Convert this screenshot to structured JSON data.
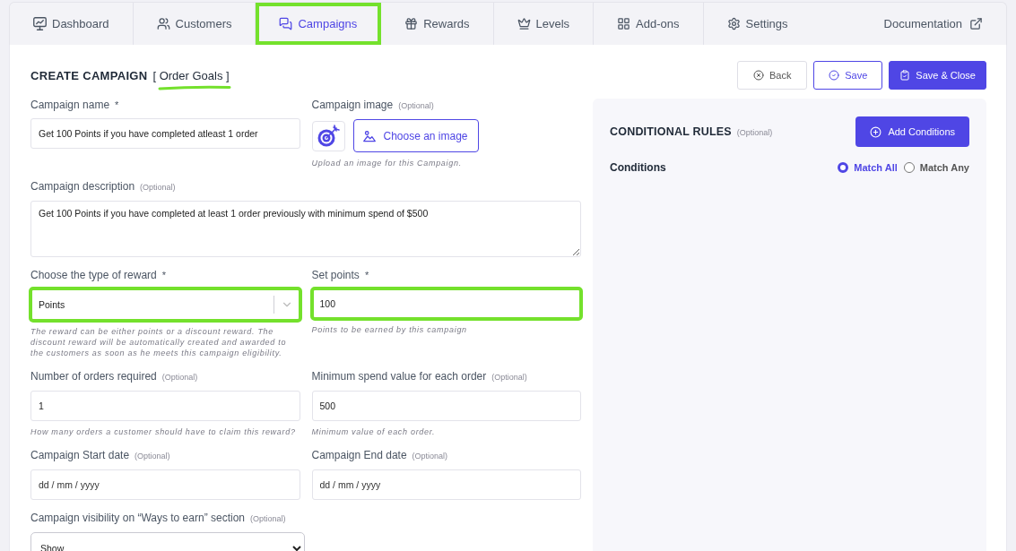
{
  "tabs": [
    {
      "label": "Dashboard",
      "selected": false,
      "highlighted": false
    },
    {
      "label": "Customers",
      "selected": false,
      "highlighted": false
    },
    {
      "label": "Campaigns",
      "selected": true,
      "highlighted": true
    },
    {
      "label": "Rewards",
      "selected": false,
      "highlighted": false
    },
    {
      "label": "Levels",
      "selected": false,
      "highlighted": false
    },
    {
      "label": "Add-ons",
      "selected": false,
      "highlighted": false
    },
    {
      "label": "Settings",
      "selected": false,
      "highlighted": false
    }
  ],
  "documentation_link": {
    "label": "Documentation"
  },
  "header": {
    "title": "CREATE CAMPAIGN",
    "campaign_type": "[ Order Goals ]",
    "underlined": true,
    "buttons": [
      {
        "kind": "back",
        "label": "Back"
      },
      {
        "kind": "save",
        "label": "Save"
      },
      {
        "kind": "save_close",
        "label": "Save & Close"
      }
    ]
  },
  "fields": [
    {
      "kind": "text",
      "label": "Campaign name",
      "required_mark": "*",
      "value": "Get 100 Points if you have completed atleast 1 order",
      "highlighted": false
    },
    {
      "kind": "image",
      "label": "Campaign image",
      "note": "(Optional)",
      "button": "Choose an image",
      "hint": "Upload an image for this Campaign.",
      "highlighted": false
    },
    {
      "kind": "textarea",
      "label": "Campaign description",
      "note": "(Optional)",
      "value": "Get 100 Points if you have completed at least 1 order previously with minimum spend of $500",
      "highlighted": false
    },
    {
      "kind": "select",
      "label": "Choose the type of reward",
      "required_mark": "*",
      "value": "Points",
      "hint": "The reward can be either points or a discount reward. The discount reward will be automatically created and awarded to the customers as soon as he meets this campaign eligibility.",
      "highlighted": true
    },
    {
      "kind": "text",
      "label": "Set points",
      "required_mark": "*",
      "value": "100",
      "hint": "Points to be earned by this campaign",
      "highlighted": true
    },
    {
      "kind": "text",
      "label": "Number of orders required",
      "note": "(Optional)",
      "value": "1",
      "hint": "How many orders a customer should have to claim this reward?",
      "highlighted": false
    },
    {
      "kind": "text",
      "label": "Minimum spend value for each order",
      "note": "(Optional)",
      "value": "500",
      "hint": "Minimum value of each order.",
      "highlighted": false
    },
    {
      "kind": "date",
      "label": "Campaign Start date",
      "note": "(Optional)",
      "placeholder": "dd / mm / yyyy",
      "highlighted": false
    },
    {
      "kind": "date",
      "label": "Campaign End date",
      "note": "(Optional)",
      "placeholder": "dd / mm / yyyy",
      "highlighted": false
    },
    {
      "kind": "dropdown",
      "label": "Campaign visibility on “Ways to earn” section",
      "note": "(Optional)",
      "value": "Show",
      "highlighted": false
    }
  ],
  "conditional_rules": {
    "title": "CONDITIONAL RULES",
    "note": "(Optional)",
    "button": "Add Conditions",
    "conditions_label": "Conditions",
    "match_options": [
      {
        "label": "Match All",
        "selected": true
      },
      {
        "label": "Match Any",
        "selected": false
      }
    ]
  }
}
